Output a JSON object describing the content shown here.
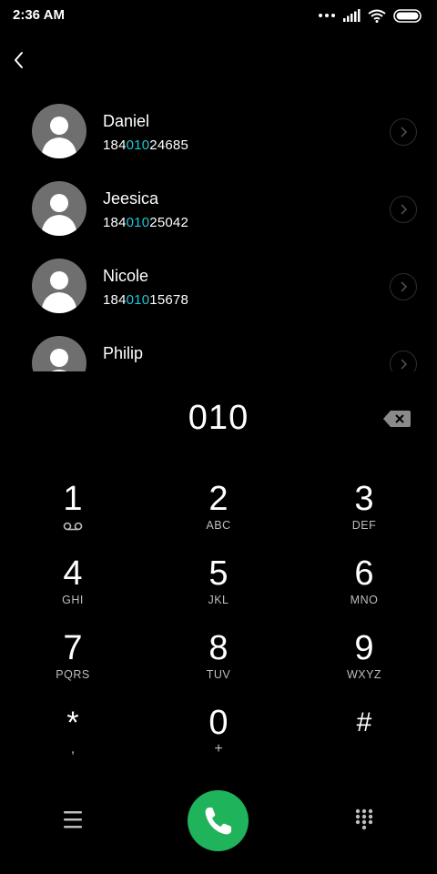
{
  "status_bar": {
    "time": "2:36 AM"
  },
  "contacts": [
    {
      "name": "Daniel",
      "number_prefix": "184",
      "number_match": "010",
      "number_suffix": "24685"
    },
    {
      "name": "Jeesica",
      "number_prefix": "184",
      "number_match": "010",
      "number_suffix": "25042"
    },
    {
      "name": "Nicole",
      "number_prefix": "184",
      "number_match": "010",
      "number_suffix": "15678"
    },
    {
      "name": "Philip",
      "number_prefix": "",
      "number_match": "",
      "number_suffix": ""
    }
  ],
  "dialed_number": "010",
  "keypad": [
    {
      "digit": "1",
      "sub": ""
    },
    {
      "digit": "2",
      "sub": "ABC"
    },
    {
      "digit": "3",
      "sub": "DEF"
    },
    {
      "digit": "4",
      "sub": "GHI"
    },
    {
      "digit": "5",
      "sub": "JKL"
    },
    {
      "digit": "6",
      "sub": "MNO"
    },
    {
      "digit": "7",
      "sub": "PQRS"
    },
    {
      "digit": "8",
      "sub": "TUV"
    },
    {
      "digit": "9",
      "sub": "WXYZ"
    },
    {
      "digit": "*",
      "sub": ","
    },
    {
      "digit": "0",
      "sub": "+"
    },
    {
      "digit": "#",
      "sub": ""
    }
  ],
  "colors": {
    "accent_match": "#1fc6d6",
    "call_button": "#1fb35b",
    "background": "#000000"
  },
  "icons": [
    "back-icon",
    "voicemail-icon",
    "backspace-icon",
    "menu-icon",
    "phone-icon",
    "keypad-grid-icon",
    "chevron-right-icon",
    "wifi-icon",
    "signal-icon",
    "battery-icon"
  ]
}
